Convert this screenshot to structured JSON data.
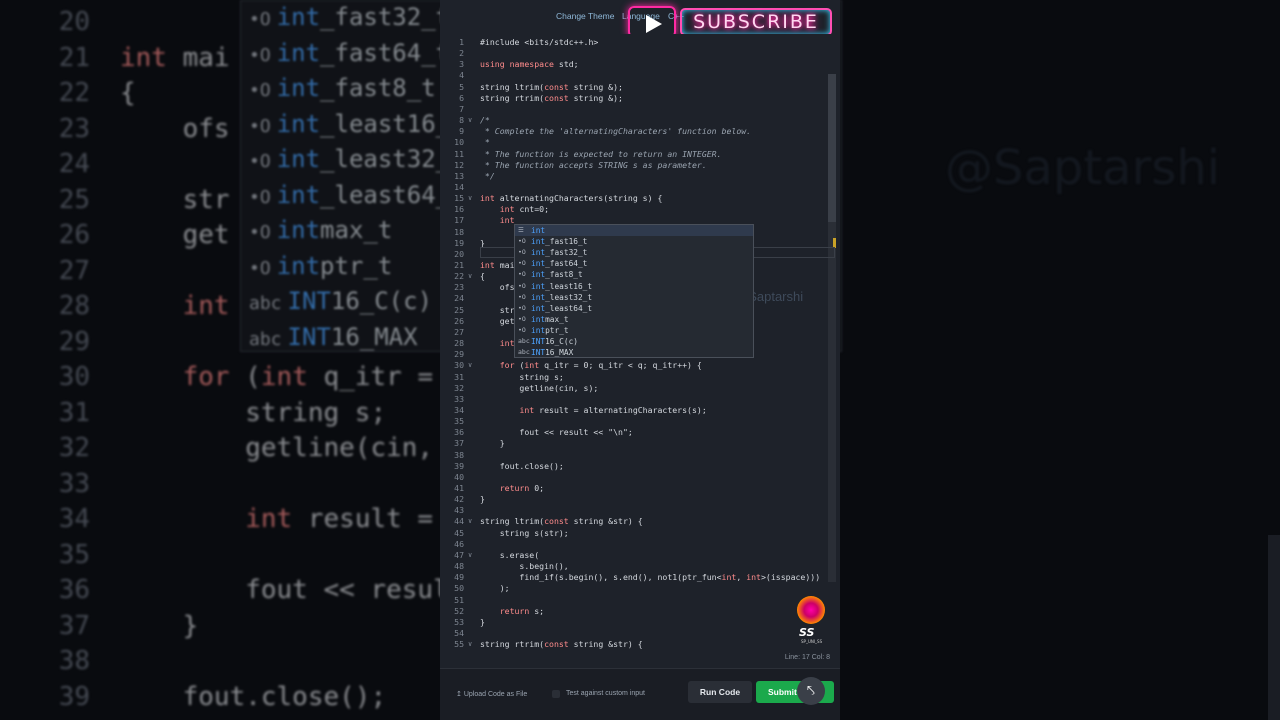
{
  "topbar": {
    "change_theme": "Change Theme",
    "language": "Language",
    "language_value": "C++"
  },
  "subscribe": {
    "label": "SUBSCRIBE"
  },
  "background_watermark": "@Saptarshi",
  "panel_watermark": "@Saptarshi",
  "background_lines": [
    {
      "num": "20",
      "text": ""
    },
    {
      "num": "21",
      "text": "int mai"
    },
    {
      "num": "22",
      "text": "{"
    },
    {
      "num": "23",
      "text": "    ofs"
    },
    {
      "num": "24",
      "text": ""
    },
    {
      "num": "25",
      "text": "    str"
    },
    {
      "num": "26",
      "text": "    get"
    },
    {
      "num": "27",
      "text": ""
    },
    {
      "num": "28",
      "text": "    int"
    },
    {
      "num": "29",
      "text": ""
    },
    {
      "num": "30",
      "text": "    for (int q_itr = 0;"
    },
    {
      "num": "31",
      "text": "        string s;"
    },
    {
      "num": "32",
      "text": "        getline(cin, s);"
    },
    {
      "num": "33",
      "text": ""
    },
    {
      "num": "34",
      "text": "        int result = alternatingCharacters(s);"
    },
    {
      "num": "35",
      "text": ""
    },
    {
      "num": "36",
      "text": "        fout << result << \"\\n\";"
    },
    {
      "num": "37",
      "text": "    }"
    },
    {
      "num": "38",
      "text": ""
    },
    {
      "num": "39",
      "text": "    fout.close();"
    }
  ],
  "background_popup": [
    {
      "icon": "•O",
      "match": "int",
      "rest": "_fast32_t"
    },
    {
      "icon": "•O",
      "match": "int",
      "rest": "_fast64_t"
    },
    {
      "icon": "•O",
      "match": "int",
      "rest": "_fast8_t"
    },
    {
      "icon": "•O",
      "match": "int",
      "rest": "_least16_"
    },
    {
      "icon": "•O",
      "match": "int",
      "rest": "_least32_"
    },
    {
      "icon": "•O",
      "match": "int",
      "rest": "_least64_"
    },
    {
      "icon": "•O",
      "match": "int",
      "rest": "max_t"
    },
    {
      "icon": "•O",
      "match": "int",
      "rest": "ptr_t"
    },
    {
      "icon": "abc",
      "match": "INT",
      "rest": "16_C(c)"
    },
    {
      "icon": "abc",
      "match": "INT",
      "rest": "16_MAX"
    }
  ],
  "code_lines": [
    {
      "n": "1",
      "fold": "",
      "t": "#include <bits/stdc++.h>"
    },
    {
      "n": "2",
      "fold": "",
      "t": ""
    },
    {
      "n": "3",
      "fold": "",
      "t": "using namespace std;"
    },
    {
      "n": "4",
      "fold": "",
      "t": ""
    },
    {
      "n": "5",
      "fold": "",
      "t": "string ltrim(const string &);"
    },
    {
      "n": "6",
      "fold": "",
      "t": "string rtrim(const string &);"
    },
    {
      "n": "7",
      "fold": "",
      "t": ""
    },
    {
      "n": "8",
      "fold": "v",
      "t": "/*"
    },
    {
      "n": "9",
      "fold": "",
      "t": " * Complete the 'alternatingCharacters' function below."
    },
    {
      "n": "10",
      "fold": "",
      "t": " *"
    },
    {
      "n": "11",
      "fold": "",
      "t": " * The function is expected to return an INTEGER."
    },
    {
      "n": "12",
      "fold": "",
      "t": " * The function accepts STRING s as parameter."
    },
    {
      "n": "13",
      "fold": "",
      "t": " */"
    },
    {
      "n": "14",
      "fold": "",
      "t": ""
    },
    {
      "n": "15",
      "fold": "v",
      "t": "int alternatingCharacters(string s) {"
    },
    {
      "n": "16",
      "fold": "",
      "t": "    int cnt=0;"
    },
    {
      "n": "17",
      "fold": "",
      "t": "    int"
    },
    {
      "n": "18",
      "fold": "",
      "t": ""
    },
    {
      "n": "19",
      "fold": "",
      "t": "}"
    },
    {
      "n": "20",
      "fold": "",
      "t": ""
    },
    {
      "n": "21",
      "fold": "",
      "t": "int mai"
    },
    {
      "n": "22",
      "fold": "v",
      "t": "{"
    },
    {
      "n": "23",
      "fold": "",
      "t": "    ofs"
    },
    {
      "n": "24",
      "fold": "",
      "t": ""
    },
    {
      "n": "25",
      "fold": "",
      "t": "    str"
    },
    {
      "n": "26",
      "fold": "",
      "t": "    get"
    },
    {
      "n": "27",
      "fold": "",
      "t": ""
    },
    {
      "n": "28",
      "fold": "",
      "t": "    int"
    },
    {
      "n": "29",
      "fold": "",
      "t": ""
    },
    {
      "n": "30",
      "fold": "v",
      "t": "    for (int q_itr = 0; q_itr < q; q_itr++) {"
    },
    {
      "n": "31",
      "fold": "",
      "t": "        string s;"
    },
    {
      "n": "32",
      "fold": "",
      "t": "        getline(cin, s);"
    },
    {
      "n": "33",
      "fold": "",
      "t": ""
    },
    {
      "n": "34",
      "fold": "",
      "t": "        int result = alternatingCharacters(s);"
    },
    {
      "n": "35",
      "fold": "",
      "t": ""
    },
    {
      "n": "36",
      "fold": "",
      "t": "        fout << result << \"\\n\";"
    },
    {
      "n": "37",
      "fold": "",
      "t": "    }"
    },
    {
      "n": "38",
      "fold": "",
      "t": ""
    },
    {
      "n": "39",
      "fold": "",
      "t": "    fout.close();"
    },
    {
      "n": "40",
      "fold": "",
      "t": ""
    },
    {
      "n": "41",
      "fold": "",
      "t": "    return 0;"
    },
    {
      "n": "42",
      "fold": "",
      "t": "}"
    },
    {
      "n": "43",
      "fold": "",
      "t": ""
    },
    {
      "n": "44",
      "fold": "v",
      "t": "string ltrim(const string &str) {"
    },
    {
      "n": "45",
      "fold": "",
      "t": "    string s(str);"
    },
    {
      "n": "46",
      "fold": "",
      "t": ""
    },
    {
      "n": "47",
      "fold": "v",
      "t": "    s.erase("
    },
    {
      "n": "48",
      "fold": "",
      "t": "        s.begin(),"
    },
    {
      "n": "49",
      "fold": "",
      "t": "        find_if(s.begin(), s.end(), not1(ptr_fun<int, int>(isspace)))"
    },
    {
      "n": "50",
      "fold": "",
      "t": "    );"
    },
    {
      "n": "51",
      "fold": "",
      "t": ""
    },
    {
      "n": "52",
      "fold": "",
      "t": "    return s;"
    },
    {
      "n": "53",
      "fold": "",
      "t": "}"
    },
    {
      "n": "54",
      "fold": "",
      "t": ""
    },
    {
      "n": "55",
      "fold": "v",
      "t": "string rtrim(const string &str) {"
    }
  ],
  "autocomplete": [
    {
      "icon": "☰",
      "match": "int",
      "rest": "",
      "selected": true
    },
    {
      "icon": "•O",
      "match": "int",
      "rest": "_fast16_t",
      "selected": false
    },
    {
      "icon": "•O",
      "match": "int",
      "rest": "_fast32_t",
      "selected": false
    },
    {
      "icon": "•O",
      "match": "int",
      "rest": "_fast64_t",
      "selected": false
    },
    {
      "icon": "•O",
      "match": "int",
      "rest": "_fast8_t",
      "selected": false
    },
    {
      "icon": "•O",
      "match": "int",
      "rest": "_least16_t",
      "selected": false
    },
    {
      "icon": "•O",
      "match": "int",
      "rest": "_least32_t",
      "selected": false
    },
    {
      "icon": "•O",
      "match": "int",
      "rest": "_least64_t",
      "selected": false
    },
    {
      "icon": "•O",
      "match": "int",
      "rest": "max_t",
      "selected": false
    },
    {
      "icon": "•O",
      "match": "int",
      "rest": "ptr_t",
      "selected": false
    },
    {
      "icon": "abc",
      "match": "INT",
      "rest": "16_C(c)",
      "selected": false
    },
    {
      "icon": "abc",
      "match": "INT",
      "rest": "16_MAX",
      "selected": false
    }
  ],
  "status": {
    "position": "Line: 17 Col: 8"
  },
  "bottom": {
    "upload": "Upload Code as File",
    "test_custom": "Test against custom input",
    "run": "Run Code",
    "submit": "Submit"
  },
  "logo": {
    "text": "SS",
    "sub": "SP_UNI_SS"
  },
  "colors": {
    "accent_green": "#1ba94c",
    "keyword": "#ff8c8c",
    "match_highlight": "#4da3ff",
    "subscribe_neon": "#ff2aa3"
  }
}
